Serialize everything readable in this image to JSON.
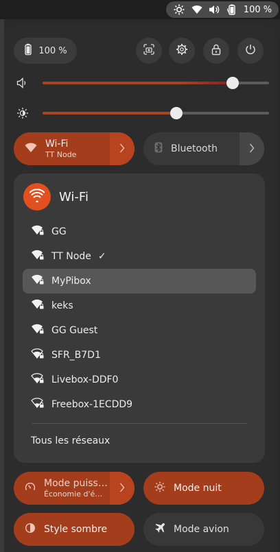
{
  "top_bar": {
    "battery_percent": "100 %"
  },
  "panel": {
    "battery_pill": "100 %",
    "volume_level": 0.84,
    "brightness_level": 0.59,
    "toggles": {
      "wifi": {
        "label": "Wi-Fi",
        "sub": "TT Node"
      },
      "bluetooth": {
        "label": "Bluetooth"
      },
      "power_mode": {
        "label": "Mode puiss…",
        "sub": "Économie d'é…"
      },
      "night_mode": {
        "label": "Mode nuit"
      },
      "dark_style": {
        "label": "Style sombre"
      },
      "airplane": {
        "label": "Mode avion"
      }
    },
    "wifi_menu": {
      "title": "Wi-Fi",
      "networks": [
        {
          "name": "GG",
          "checked": ""
        },
        {
          "name": "TT Node",
          "checked": "✓"
        },
        {
          "name": "MyPibox",
          "checked": ""
        },
        {
          "name": "keks",
          "checked": ""
        },
        {
          "name": "GG Guest",
          "checked": ""
        },
        {
          "name": "SFR_B7D1",
          "checked": ""
        },
        {
          "name": "Livebox-DDF0",
          "checked": ""
        },
        {
          "name": "Freebox-1ECDD9",
          "checked": ""
        }
      ],
      "all_networks": "Tous les réseaux"
    }
  },
  "colors": {
    "accent": "#e2501f",
    "toggle_on": "#a33d1c"
  }
}
